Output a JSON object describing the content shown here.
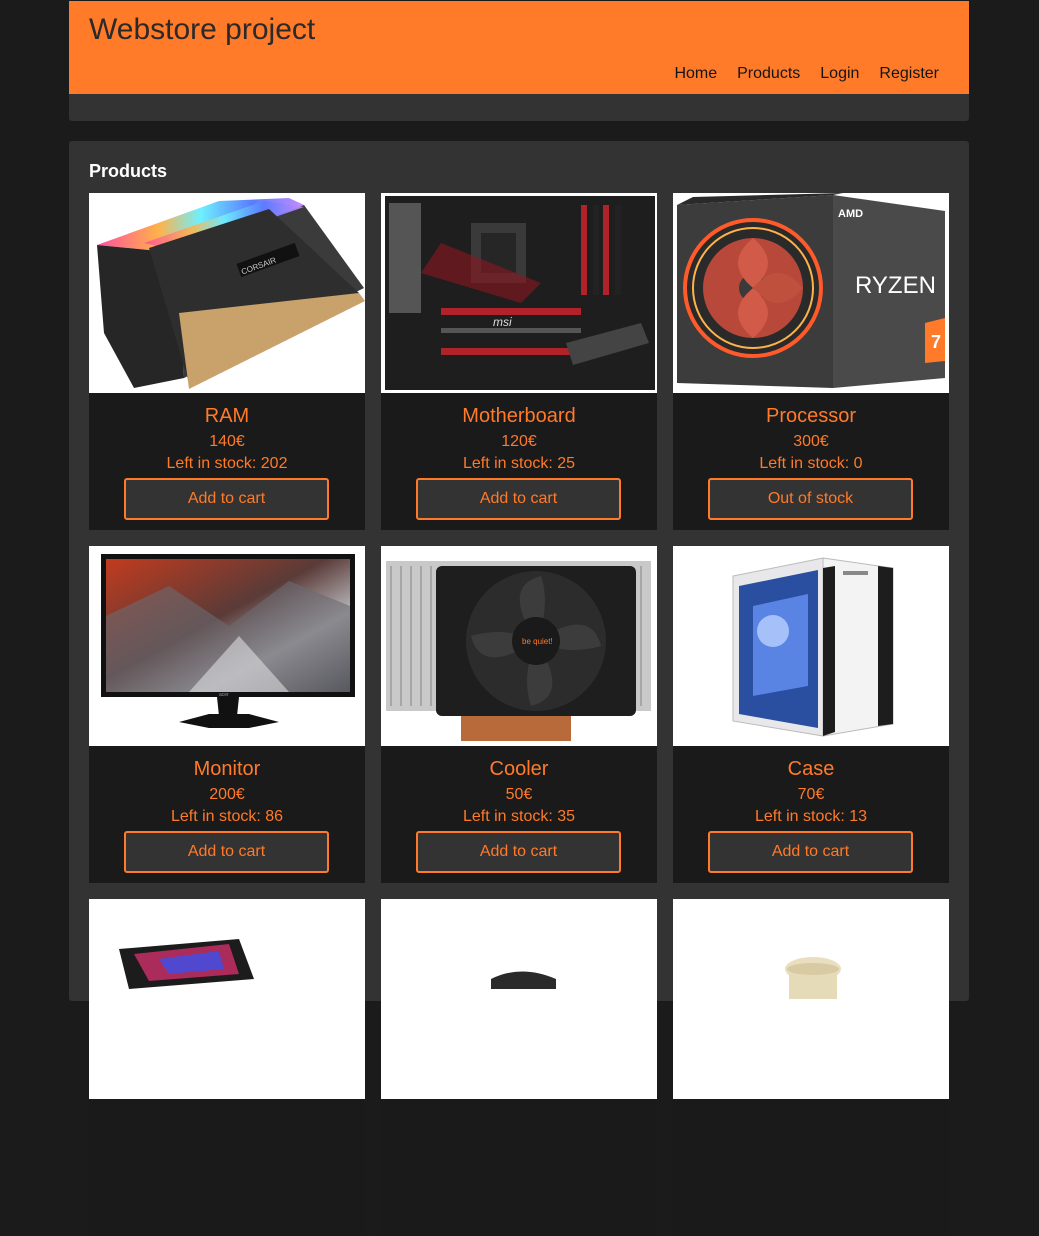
{
  "header": {
    "title": "Webstore project",
    "nav": [
      "Home",
      "Products",
      "Login",
      "Register"
    ]
  },
  "products_section": {
    "heading": "Products"
  },
  "products": [
    {
      "name": "RAM",
      "price": "140€",
      "stock": "Left in stock: 202",
      "button": "Add to cart",
      "image": "ram-image"
    },
    {
      "name": "Motherboard",
      "price": "120€",
      "stock": "Left in stock: 25",
      "button": "Add to cart",
      "image": "motherboard-image"
    },
    {
      "name": "Processor",
      "price": "300€",
      "stock": "Left in stock: 0",
      "button": "Out of stock",
      "image": "processor-image"
    },
    {
      "name": "Monitor",
      "price": "200€",
      "stock": "Left in stock: 86",
      "button": "Add to cart",
      "image": "monitor-image"
    },
    {
      "name": "Cooler",
      "price": "50€",
      "stock": "Left in stock: 35",
      "button": "Add to cart",
      "image": "cooler-image"
    },
    {
      "name": "Case",
      "price": "70€",
      "stock": "Left in stock: 13",
      "button": "Add to cart",
      "image": "case-image"
    },
    {
      "image": "laptop-image"
    },
    {
      "image": "product-image"
    },
    {
      "image": "mouse-image"
    }
  ],
  "image_text": {
    "ram_brand": "CORSAIR",
    "motherboard_brand": "msi",
    "processor_brand": "AMD",
    "processor_model": "RYZEN",
    "processor_tier": "7",
    "monitor_brand": "acer",
    "cooler_brand": "be quiet!"
  },
  "colors": {
    "accent": "#ff7a29",
    "page_bg": "#1b1b1b",
    "panel_bg": "#333333",
    "card_bg": "#1a1a1a"
  }
}
